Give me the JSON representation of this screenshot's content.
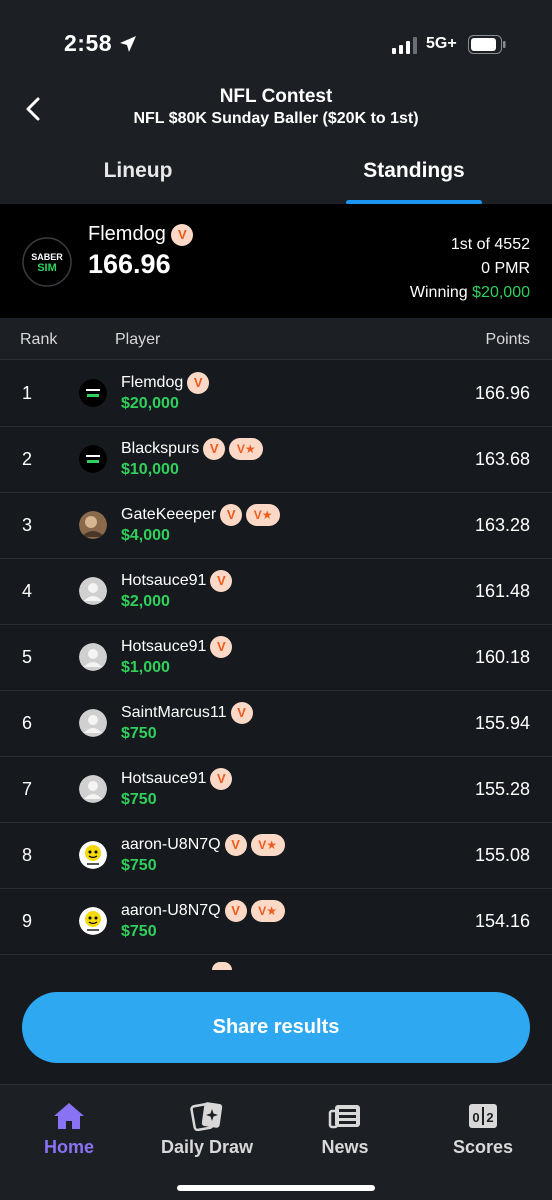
{
  "status_bar": {
    "time": "2:58",
    "network": "5G+"
  },
  "header": {
    "title": "NFL Contest",
    "subtitle": "NFL $80K Sunday Baller ($20K to 1st)"
  },
  "tabs": [
    {
      "label": "Lineup"
    },
    {
      "label": "Standings",
      "active": true
    }
  ],
  "summary": {
    "logo_top": "SABER",
    "logo_bottom": "SIM",
    "name": "Flemdog",
    "badge": "V",
    "score": "166.96",
    "rank_text": "1st of 4552",
    "pmr_text": "0 PMR",
    "winning_label": "Winning",
    "winning_amount": "$20,000"
  },
  "columns": {
    "rank": "Rank",
    "player": "Player",
    "points": "Points"
  },
  "badge_labels": {
    "v": "V",
    "vstar": "V★"
  },
  "rows": [
    {
      "rank": "1",
      "name": "Flemdog",
      "prize": "$20,000",
      "points": "166.96",
      "avatar": "sabersim-logo",
      "vstar": false
    },
    {
      "rank": "2",
      "name": "Blackspurs",
      "prize": "$10,000",
      "points": "163.68",
      "avatar": "sabersim-logo",
      "vstar": true
    },
    {
      "rank": "3",
      "name": "GateKeeeper",
      "prize": "$4,000",
      "points": "163.28",
      "avatar": "photo-avatar",
      "vstar": true
    },
    {
      "rank": "4",
      "name": "Hotsauce91",
      "prize": "$2,000",
      "points": "161.48",
      "avatar": "default-avatar",
      "vstar": false
    },
    {
      "rank": "5",
      "name": "Hotsauce91",
      "prize": "$1,000",
      "points": "160.18",
      "avatar": "default-avatar",
      "vstar": false
    },
    {
      "rank": "6",
      "name": "SaintMarcus11",
      "prize": "$750",
      "points": "155.94",
      "avatar": "default-avatar",
      "vstar": false
    },
    {
      "rank": "7",
      "name": "Hotsauce91",
      "prize": "$750",
      "points": "155.28",
      "avatar": "default-avatar",
      "vstar": false
    },
    {
      "rank": "8",
      "name": "aaron-U8N7Q",
      "prize": "$750",
      "points": "155.08",
      "avatar": "cartoon-avatar",
      "vstar": true
    },
    {
      "rank": "9",
      "name": "aaron-U8N7Q",
      "prize": "$750",
      "points": "154.16",
      "avatar": "cartoon-avatar",
      "vstar": true
    }
  ],
  "share_button": {
    "label": "Share results"
  },
  "bottom_nav": [
    {
      "label": "Home",
      "icon": "home-icon",
      "active": true
    },
    {
      "label": "Daily Draw",
      "icon": "daily-draw-icon"
    },
    {
      "label": "News",
      "icon": "news-icon"
    },
    {
      "label": "Scores",
      "icon": "scores-icon"
    }
  ],
  "colors": {
    "accent": "#1a96f0",
    "money": "#2fd05c",
    "share_button": "#2fa8f2",
    "nav_active": "#8a72f5",
    "badge_bg": "#fbd9c6",
    "badge_text": "#ef5b1c"
  }
}
